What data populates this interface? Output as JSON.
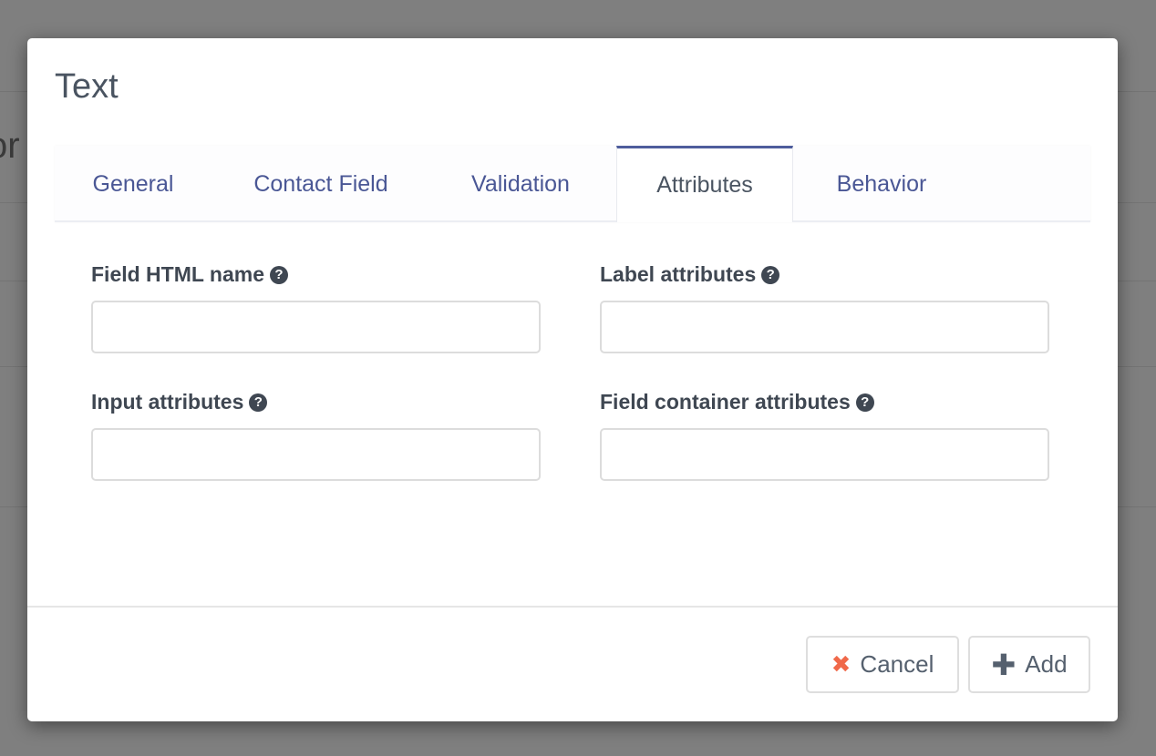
{
  "modal": {
    "title": "Text",
    "tabs": [
      {
        "label": "General",
        "active": false
      },
      {
        "label": "Contact Field",
        "active": false
      },
      {
        "label": "Validation",
        "active": false
      },
      {
        "label": "Attributes",
        "active": true
      },
      {
        "label": "Behavior",
        "active": false
      }
    ],
    "fields": [
      {
        "label": "Field HTML name",
        "value": ""
      },
      {
        "label": "Label attributes",
        "value": ""
      },
      {
        "label": "Input attributes",
        "value": ""
      },
      {
        "label": "Field container attributes",
        "value": ""
      }
    ],
    "help_glyph": "?",
    "buttons": {
      "cancel": "Cancel",
      "cancel_icon": "✖",
      "add": "Add",
      "add_icon": "✚"
    }
  },
  "background": {
    "partial_text": "or"
  },
  "colors": {
    "accent": "#4e5d9c",
    "tab_text": "#4a5795",
    "cancel_icon": "#f0694a",
    "overlay": "#7f7f7f"
  }
}
